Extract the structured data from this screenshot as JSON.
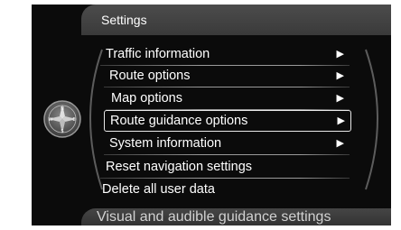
{
  "header": {
    "title": "Settings"
  },
  "menu": {
    "items": [
      {
        "label": "Traffic information",
        "arrow": "▶",
        "selected": false
      },
      {
        "label": "Route options",
        "arrow": "▶",
        "selected": false
      },
      {
        "label": "Map options",
        "arrow": "▶",
        "selected": false
      },
      {
        "label": "Route guidance options",
        "arrow": "▶",
        "selected": true
      },
      {
        "label": "System information",
        "arrow": "▶",
        "selected": false
      },
      {
        "label": "Reset navigation settings",
        "arrow": "",
        "selected": false
      },
      {
        "label": "Delete all user data",
        "arrow": "",
        "selected": false
      }
    ]
  },
  "footer": {
    "help_text": "Visual and audible guidance settings"
  },
  "icons": {
    "compass": "compass-icon",
    "submenu_arrow": "chevron-right-icon"
  },
  "colors": {
    "background": "#0b0b0b",
    "bar": "#444444",
    "text": "#ffffff",
    "footer_text": "#d2d2d2",
    "selection_border": "#e8e8e8"
  }
}
